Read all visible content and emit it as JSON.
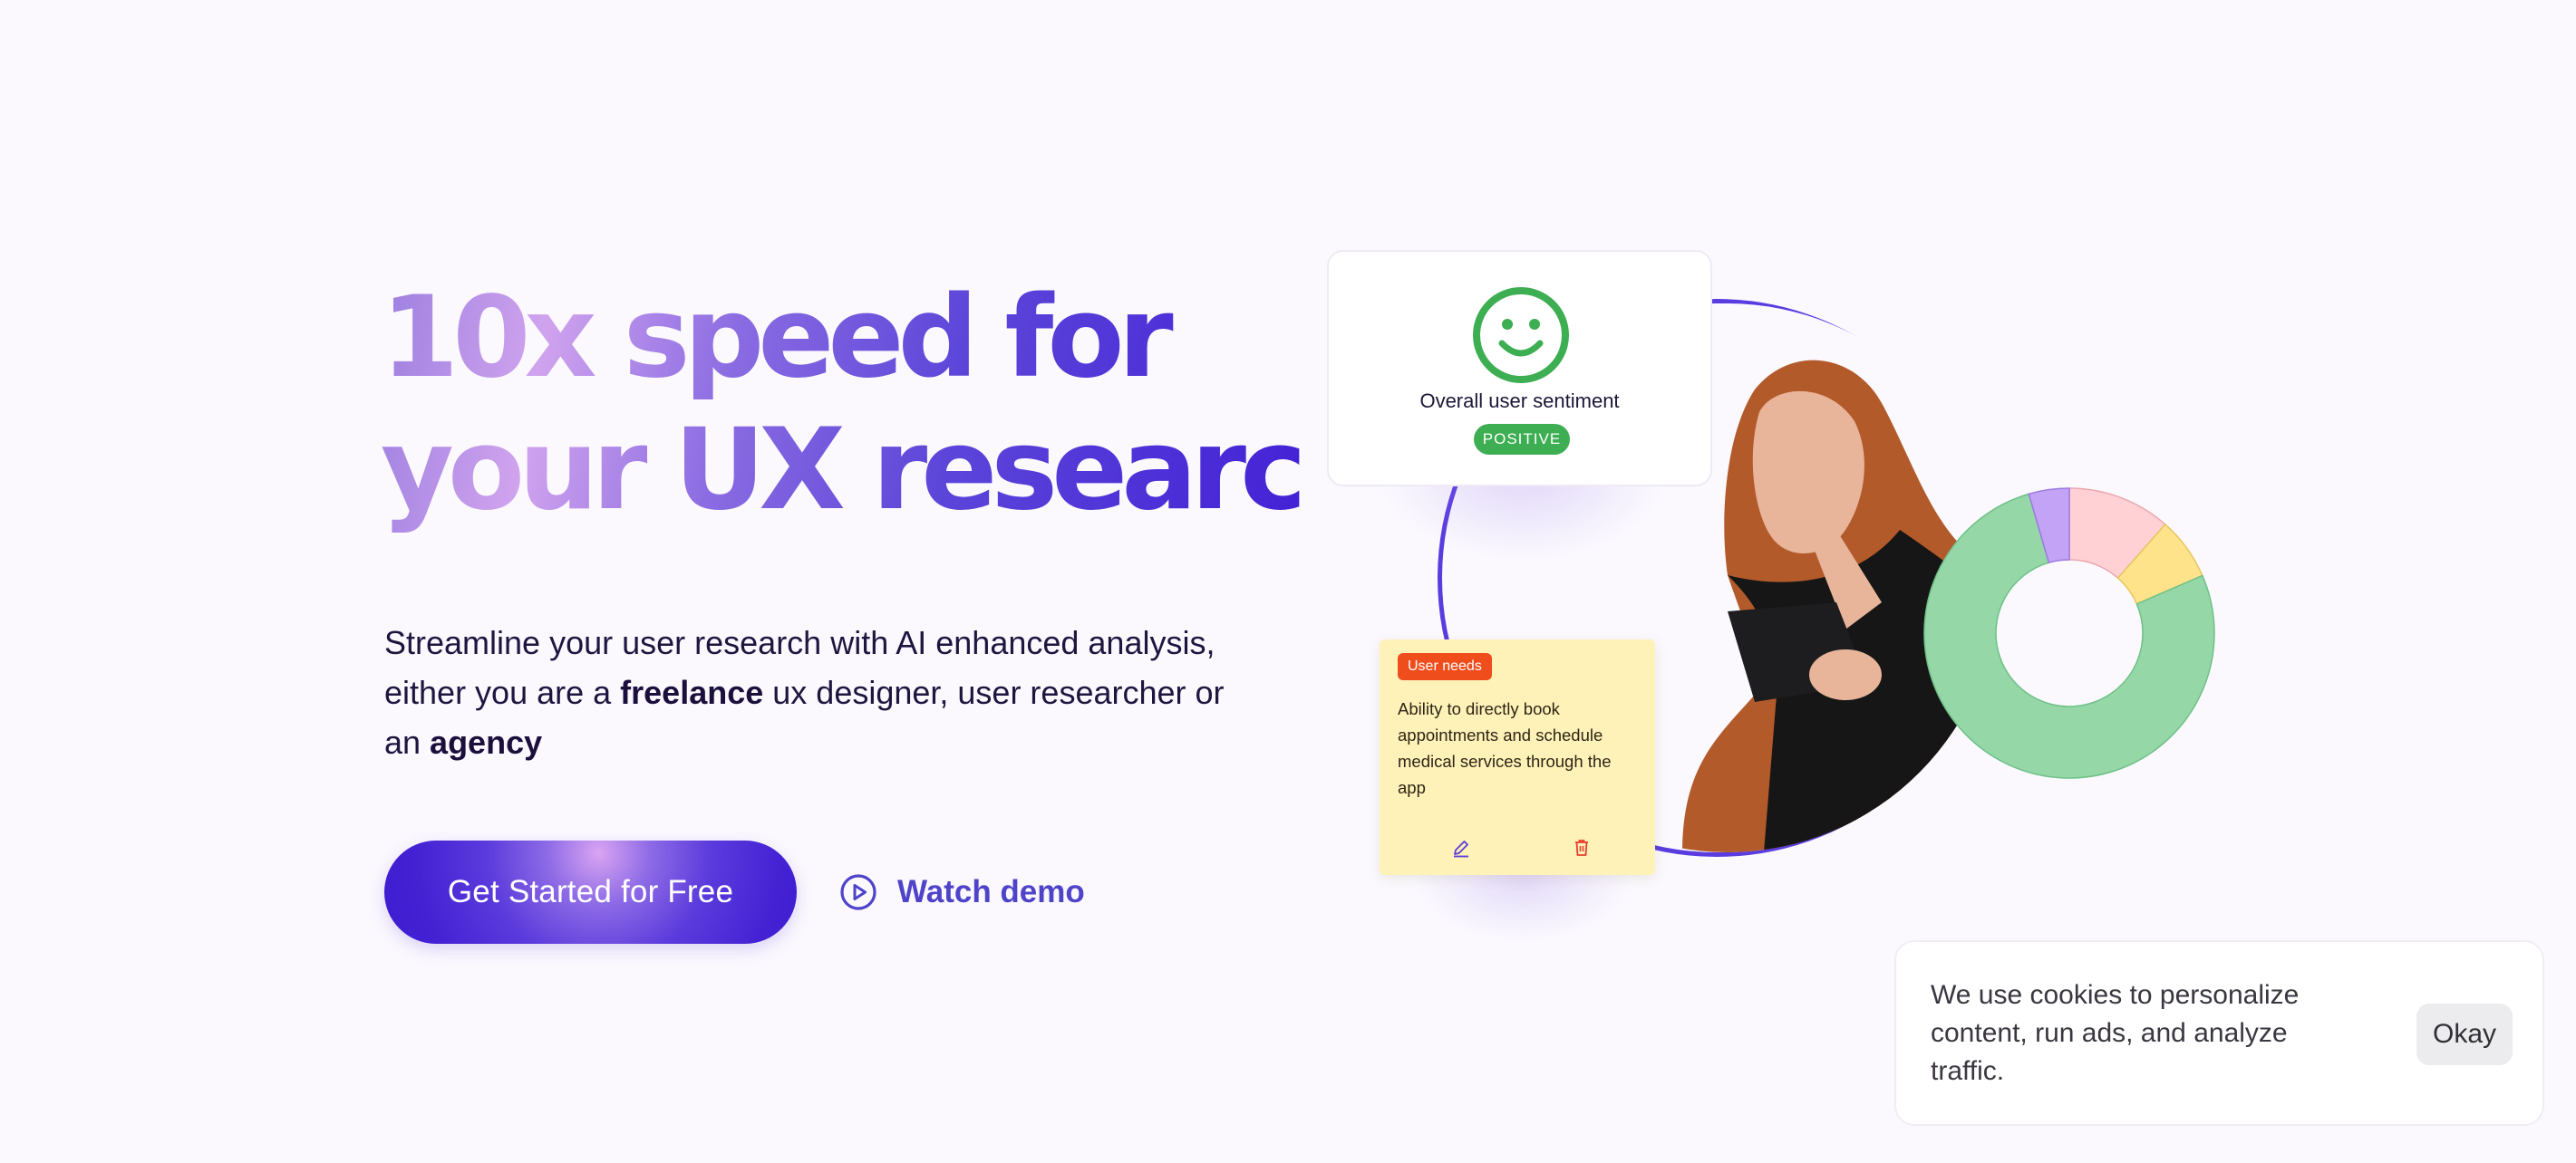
{
  "hero": {
    "headline_line1": "10x speed for",
    "headline_line2": "your UX research",
    "sub_part1": "Streamline your user research with AI enhanced analysis, either you are a ",
    "sub_bold1": "freelance",
    "sub_part2": " ux designer, user researcher or an ",
    "sub_bold2": "agency",
    "cta_label": "Get Started for Free",
    "demo_label": "Watch demo",
    "demo_icon": "play-circle-icon"
  },
  "sentiment_card": {
    "icon": "smiley-face-icon",
    "label": "Overall user sentiment",
    "badge": "POSITIVE"
  },
  "note_card": {
    "tag": "User needs",
    "text": "Ability to directly book appointments and schedule medical services through the app",
    "edit_icon": "pencil-icon",
    "delete_icon": "trash-icon"
  },
  "donut": {
    "segments": [
      {
        "color": "#ffd1d4",
        "stroke": "#eba7ad",
        "share": 0.115
      },
      {
        "color": "#ffe38a",
        "stroke": "#e6c660",
        "share": 0.07
      },
      {
        "color": "#95d7a7",
        "stroke": "#6fc187",
        "share": 0.77
      },
      {
        "color": "#c3a3f5",
        "stroke": "#9d79e3",
        "share": 0.045
      }
    ]
  },
  "cookie_banner": {
    "text": "We use cookies to personalize content, run ads, and analyze traffic.",
    "button": "Okay"
  },
  "colors": {
    "brand_primary": "#4321d6",
    "brand_link": "#4f44c9",
    "positive": "#3dae52",
    "note_bg": "#fff2b8",
    "note_tag": "#f04d1d"
  }
}
